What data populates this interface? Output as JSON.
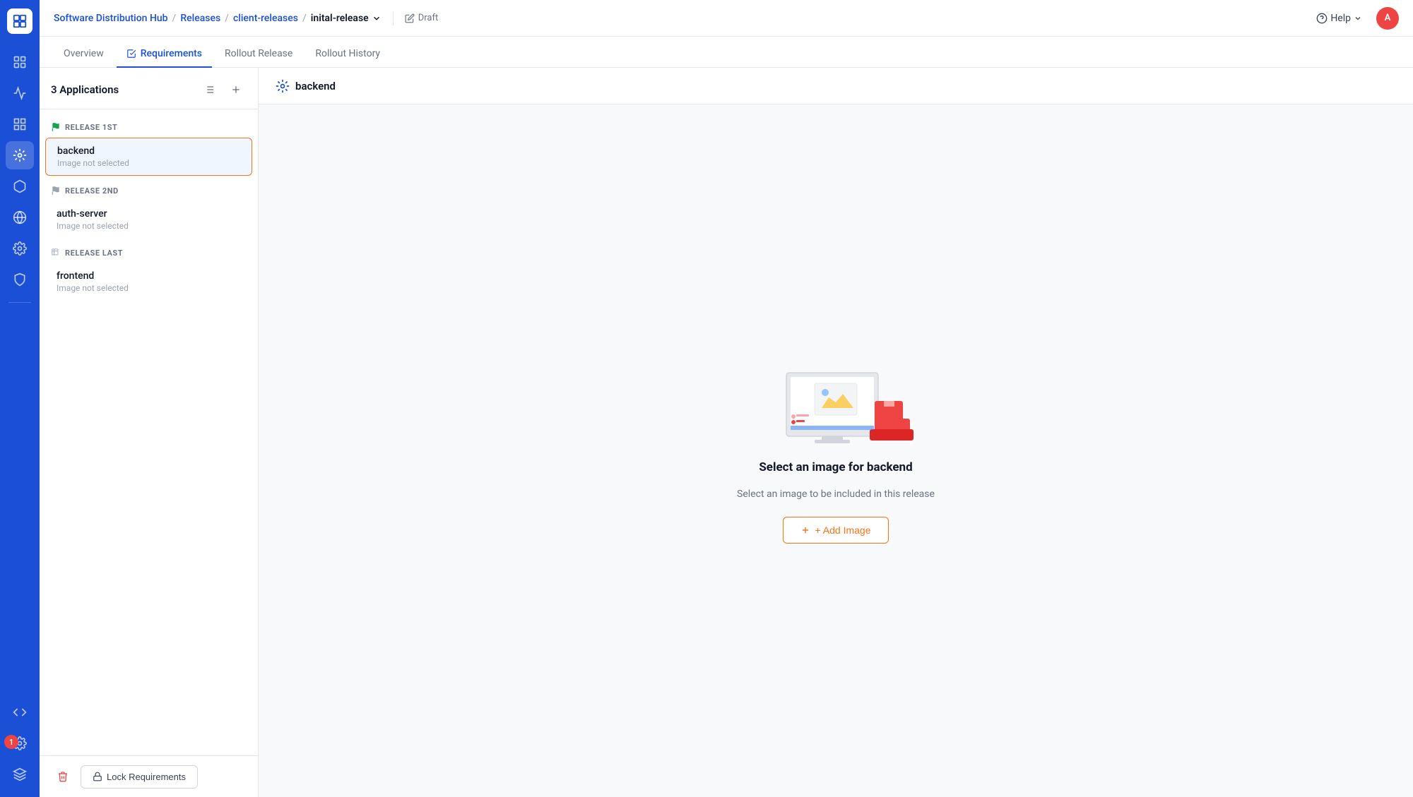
{
  "breadcrumb": {
    "hub": "Software Distribution Hub",
    "releases": "Releases",
    "client_releases": "client-releases",
    "release_name": "inital-release",
    "separator": "/"
  },
  "draft": {
    "label": "Draft"
  },
  "help": {
    "label": "Help"
  },
  "avatar": {
    "initial": "A"
  },
  "tabs": [
    {
      "id": "overview",
      "label": "Overview"
    },
    {
      "id": "requirements",
      "label": "Requirements"
    },
    {
      "id": "rollout_release",
      "label": "Rollout Release"
    },
    {
      "id": "rollout_history",
      "label": "Rollout History"
    }
  ],
  "left_panel": {
    "title": "3 Applications",
    "releases": [
      {
        "id": "release_1st",
        "flag_type": "green",
        "label": "RELEASE 1ST",
        "apps": [
          {
            "name": "backend",
            "sub": "Image not selected",
            "active": true
          }
        ]
      },
      {
        "id": "release_2nd",
        "flag_type": "gray",
        "label": "RELEASE 2ND",
        "apps": [
          {
            "name": "auth-server",
            "sub": "Image not selected",
            "active": false
          }
        ]
      },
      {
        "id": "release_last",
        "flag_type": "gray",
        "label": "RELEASE LAST",
        "apps": [
          {
            "name": "frontend",
            "sub": "Image not selected",
            "active": false
          }
        ]
      }
    ],
    "lock_btn_label": "Lock Requirements"
  },
  "right_panel": {
    "header_title": "backend",
    "empty_title": "Select an image for backend",
    "empty_subtitle": "Select an image to be included in this release",
    "add_image_btn": "+ Add Image"
  }
}
